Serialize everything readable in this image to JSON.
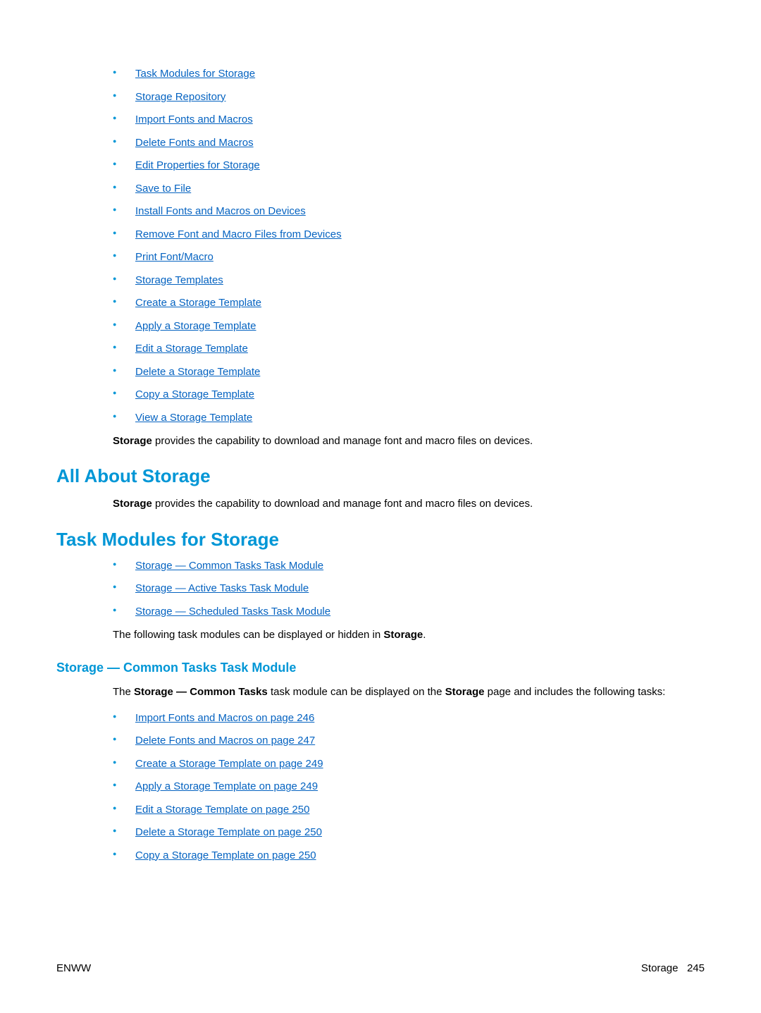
{
  "toc": [
    "Task Modules for Storage",
    "Storage Repository",
    "Import Fonts and Macros",
    "Delete Fonts and Macros",
    "Edit Properties for Storage",
    "Save to File",
    "Install Fonts and Macros on Devices",
    "Remove Font and Macro Files from Devices",
    "Print Font/Macro",
    "Storage Templates",
    "Create a Storage Template",
    "Apply a Storage Template",
    "Edit a Storage Template",
    "Delete a Storage Template",
    "Copy a Storage Template",
    "View a Storage Template"
  ],
  "para1_bold": "Storage",
  "para1_rest": " provides the capability to download and manage font and macro files on devices.",
  "h1_a": "All About Storage",
  "para2_bold": "Storage",
  "para2_rest": " provides the capability to download and manage font and macro files on devices.",
  "h1_b": "Task Modules for Storage",
  "sub_toc": [
    "Storage — Common Tasks Task Module",
    "Storage — Active Tasks Task Module",
    "Storage — Scheduled Tasks Task Module"
  ],
  "para3_a": "The following task modules can be displayed or hidden in ",
  "para3_bold": "Storage",
  "para3_b": ".",
  "h2_a": "Storage — Common Tasks Task Module",
  "para4_a": "The ",
  "para4_bold1": "Storage — Common Tasks",
  "para4_b": " task module can be displayed on the ",
  "para4_bold2": "Storage",
  "para4_c": " page and includes the following tasks:",
  "tasks": [
    "Import Fonts and Macros on page 246",
    "Delete Fonts and Macros on page 247",
    "Create a Storage Template on page 249",
    "Apply a Storage Template on page 249",
    "Edit a Storage Template on page 250",
    "Delete a Storage Template on page 250",
    "Copy a Storage Template on page 250"
  ],
  "footer_left": "ENWW",
  "footer_right_label": "Storage",
  "footer_right_page": "245"
}
